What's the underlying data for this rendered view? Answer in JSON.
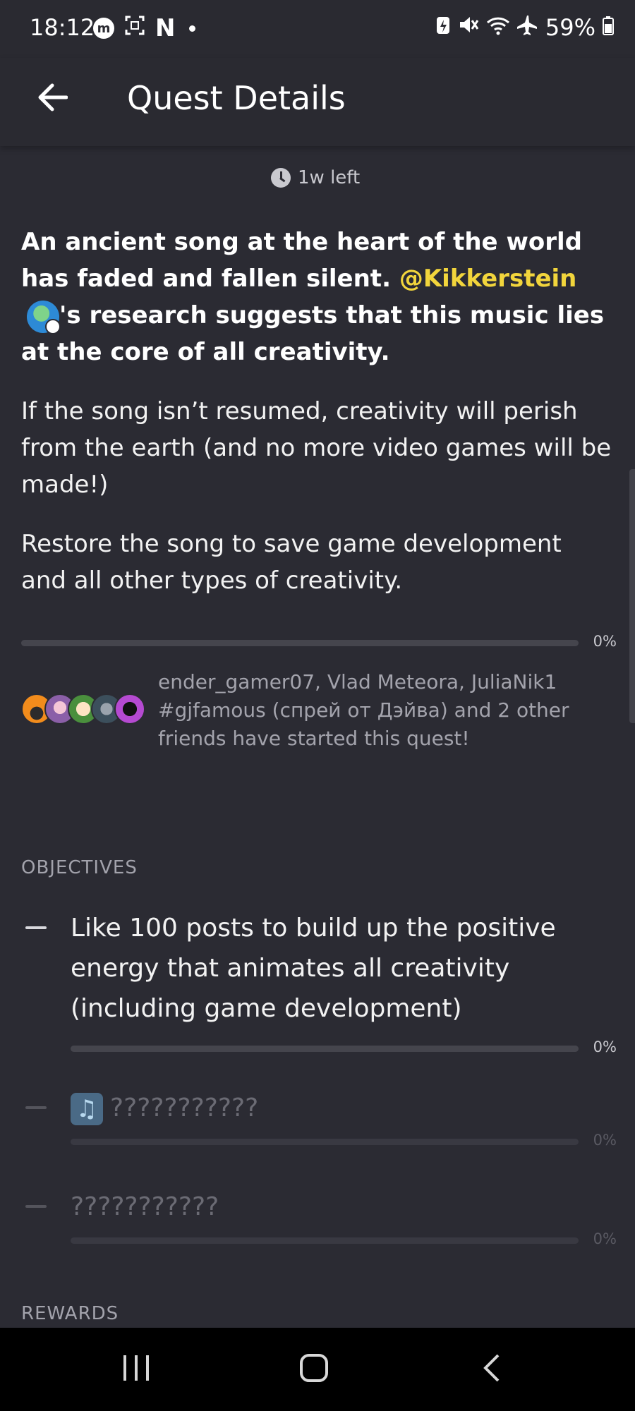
{
  "status_bar": {
    "time": "18:12",
    "battery": "59%",
    "left_icons": [
      "messenger-icon",
      "screenshot-icon",
      "netflix-icon",
      "dot-icon"
    ],
    "right_icons": [
      "battery-saver-icon",
      "mute-icon",
      "wifi-icon",
      "airplane-icon",
      "battery-icon"
    ],
    "netflix_letter": "N"
  },
  "app_bar": {
    "title": "Quest Details"
  },
  "quest": {
    "time_left": "1w left",
    "intro_part1": "An ancient song at the heart of the world has faded and fallen silent. ",
    "mention": "@Kikkerstein",
    "intro_part2": "'s research suggests that this music lies at the core of all creativity.",
    "paragraph2": "If the song isn’t resumed, creativity will perish from the earth (and no more video games will be made!)",
    "paragraph3": "Restore the song to save game development and all other types of creativity.",
    "progress_percent": "0%",
    "progress_fraction": 0
  },
  "friends": {
    "text": "ender_gamer07, Vlad Meteora, JuliaNik1 #gjfamous (спрей от Дэйва) and 2 other friends have started this quest!"
  },
  "objectives": {
    "section_title": "OBJECTIVES",
    "items": [
      {
        "text": "Like 100 posts to build up the positive energy that animates all creativity (including game development)",
        "percent": "0%"
      },
      {
        "text": "???????????",
        "percent": "0%"
      },
      {
        "text": "???????????",
        "percent": "0%"
      }
    ]
  },
  "rewards": {
    "section_title": "REWARDS"
  },
  "colors": {
    "background": "#2b2b33",
    "mention": "#f2d53c",
    "muted_text": "#a3a3ac"
  }
}
